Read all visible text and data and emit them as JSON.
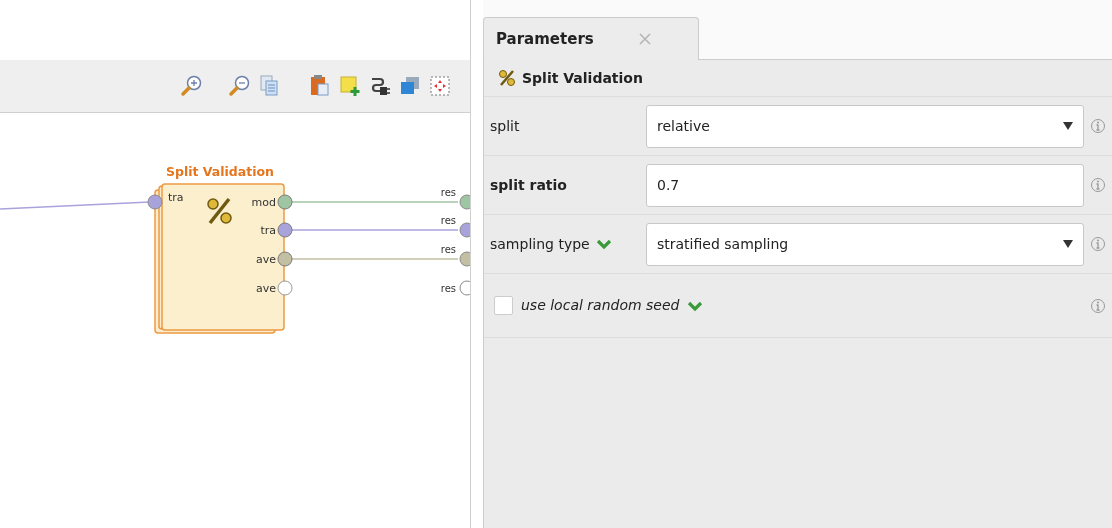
{
  "process": {
    "operator": {
      "title": "Split Validation",
      "inputs": [
        {
          "label": "tra",
          "color": "#a9a3dc",
          "connected": true
        }
      ],
      "outputs": [
        {
          "label": "mod",
          "color": "#9fc6a3",
          "connected": true
        },
        {
          "label": "tra",
          "color": "#a9a3dc",
          "connected": true
        },
        {
          "label": "ave",
          "color": "#c2bfa3",
          "connected": true
        },
        {
          "label": "ave",
          "color": "#ffffff",
          "connected": false
        }
      ]
    },
    "results": [
      {
        "label": "res",
        "color": "#9fc6a3"
      },
      {
        "label": "res",
        "color": "#a9a3dc"
      },
      {
        "label": "res",
        "color": "#c2bfa3"
      },
      {
        "label": "res",
        "color": "#ffffff"
      }
    ]
  },
  "parameters": {
    "tab": {
      "label": "Parameters",
      "selected": true
    },
    "operator": "Split Validation",
    "rows": [
      {
        "kind": "select",
        "label": "split",
        "bold": false,
        "expandable": false,
        "value": "relative"
      },
      {
        "kind": "text",
        "label": "split ratio",
        "bold": true,
        "expandable": false,
        "value": "0.7"
      },
      {
        "kind": "select",
        "label": "sampling type",
        "bold": false,
        "expandable": true,
        "value": "stratified sampling"
      },
      {
        "kind": "checkbox",
        "label": "use local random seed",
        "bold": false,
        "expandable": true,
        "checked": false
      }
    ]
  }
}
